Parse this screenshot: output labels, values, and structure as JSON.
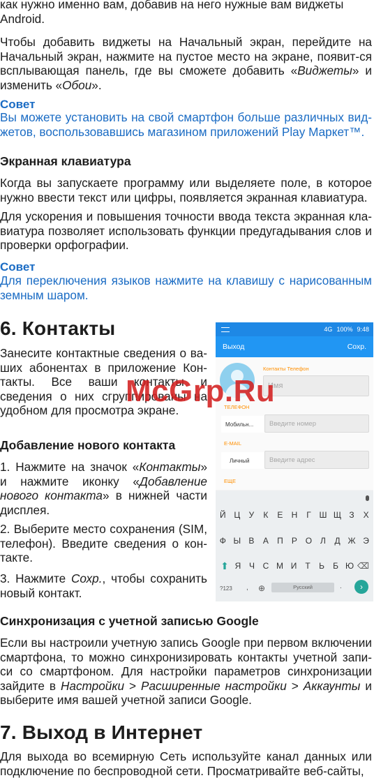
{
  "top": {
    "p0_l1": "как нужно именно вам, добавив на него нужные вам виджеты",
    "p0_l2": "Android.",
    "p1_a": "Чтобы добавить виджеты на Начальный экран, перейдите на Начальный экран, нажмите на пустое место на экране, появит-ся всплывающая панель, где вы сможете добавить «",
    "p1_em1": "Виджеты",
    "p1_b": "» и изменить «",
    "p1_em2": "Обои",
    "p1_c": "».",
    "tip1_head": "Совет",
    "tip1_text": "Вы можете установить на свой смартфон больше различных вид-жетов, воспользовавшись магазином приложений Play Маркет™."
  },
  "keyboard_section": {
    "heading": "Экранная клавиатура",
    "p1": "Когда вы запускаете программу или выделяете поле, в которое нужно ввести текст или цифры, появляется экранная клавиатура.",
    "p2": "Для ускорения и повышения точности ввода текста экранная кла-виатура позволяет использовать функции предугадывания слов и проверки орфографии.",
    "tip_head": "Совет",
    "tip_text": "Для переключения языков нажмите на клавишу  с нарисованным земным шаром."
  },
  "contacts": {
    "heading": "6. Контакты",
    "intro": "Занесите контактные сведения о ва-ших абонентах в приложение Кон-такты. Все ваши контакты и сведения о них сгруппированы на удобном для просмотра экране.",
    "add_heading": "Добавление нового контакта",
    "s1_a": "1. Нажмите на значок «",
    "s1_em1": "Контакты",
    "s1_b": "» и нажмите иконку «",
    "s1_em2": "Добавление нового контакта",
    "s1_c": "» в нижней части дисплея.",
    "s2": "2. Выберите место сохранения (SIM, телефон). Введите сведения о кон-такте.",
    "s3_a": "3. Нажмите ",
    "s3_em": "Сохр.",
    "s3_b": ", чтобы сохранить новый контакт."
  },
  "sync": {
    "heading": "Синхронизация с учетной записью Google",
    "p_a": "Если вы настроили учетную запись Google при первом включении смартфона, то можно синхронизировать контакты учетной запи-си со смартфоном. Для настройки параметров синхронизации зайдите в ",
    "p_em1": "Настройки",
    "p_sep1": " > ",
    "p_em2": "Расширенные настройки",
    "p_sep2": " > ",
    "p_em3": "Аккаунты",
    "p_b": " и выберите имя вашей учетной записи Google."
  },
  "internet": {
    "heading": "7. Выход в Интернет",
    "p": "Для выхода во всемирную Сеть используйте канал данных или подключение по беспроводной сети. Просматривайте веб-сайты,"
  },
  "watermark": "McGrp.Ru",
  "phone": {
    "status": {
      "network": "4G",
      "battery": "100%",
      "time": "9:48"
    },
    "appbar": {
      "back": "Выход",
      "save": "Сохр."
    },
    "account_label": "Контакты Телефон",
    "name_placeholder": "Имя",
    "phone_label": "ТЕЛЕФОН",
    "phone_type": "Мобильн...",
    "phone_placeholder": "Введите номер",
    "email_label": "E-MAIL",
    "email_type": "Личный",
    "email_placeholder": "Введите адрес",
    "more_label": "ЕЩЕ",
    "keyboard": {
      "row1": [
        "Й",
        "Ц",
        "У",
        "К",
        "Е",
        "Н",
        "Г",
        "Ш",
        "Щ",
        "З",
        "Х"
      ],
      "row2": [
        "Ф",
        "Ы",
        "В",
        "А",
        "П",
        "Р",
        "О",
        "Л",
        "Д",
        "Ж",
        "Э"
      ],
      "row3": [
        "Я",
        "Ч",
        "С",
        "М",
        "И",
        "Т",
        "Ь",
        "Б",
        "Ю"
      ],
      "k123": "?123",
      "comma": ",",
      "space": "Русский",
      "dot": "."
    }
  }
}
